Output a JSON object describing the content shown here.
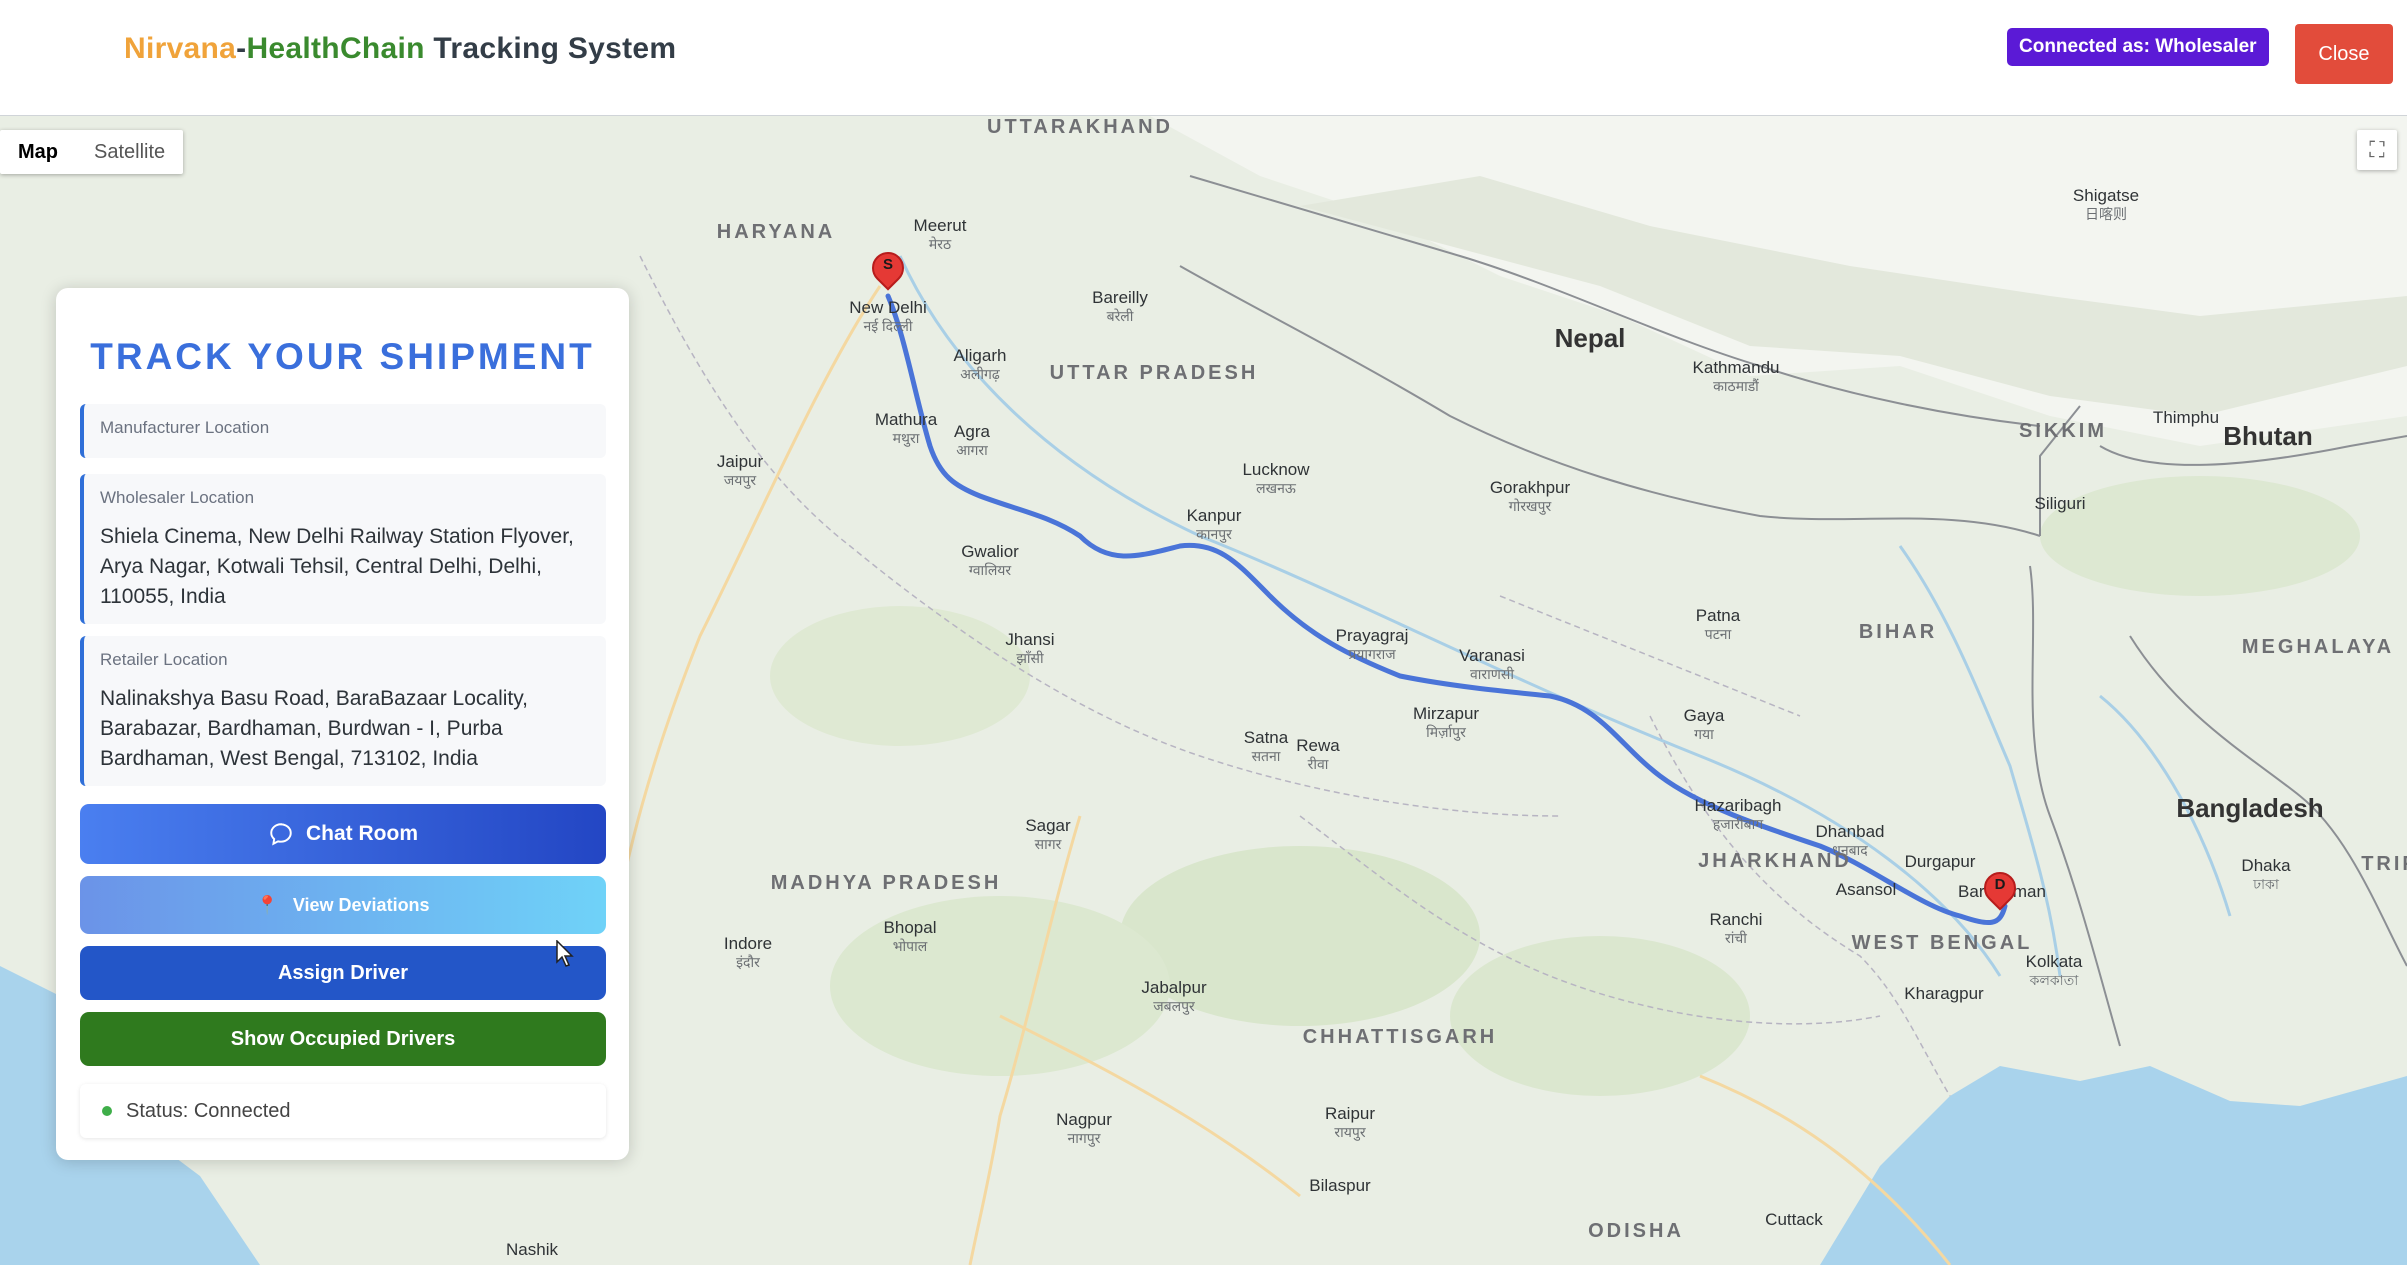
{
  "header": {
    "brand_part1": "Nirvana",
    "brand_sep": "-",
    "brand_part2": "HealthChain",
    "brand_part3": " Tracking System",
    "connected_badge": "Connected as: Wholesaler",
    "close_label": "Close"
  },
  "map": {
    "map_type": {
      "map": "Map",
      "satellite": "Satellite",
      "active": "Map"
    },
    "fullscreen_icon": "fullscreen-icon",
    "route_color": "#4a74d8",
    "markers": {
      "start_label": "S",
      "end_label": "D"
    },
    "countries": [
      "Nepal",
      "Bhutan",
      "Bangladesh"
    ],
    "states": [
      "UTTARAKHAND",
      "HARYANA",
      "UTTAR PRADESH",
      "BIHAR",
      "JHARKHAND",
      "WEST BENGAL",
      "MADHYA PRADESH",
      "CHHATTISGARH",
      "SIKKIM",
      "MEGHALAYA",
      "ODISHA",
      "TRIP"
    ],
    "cities": [
      {
        "en": "New Delhi",
        "local": "नई दिल्ली"
      },
      {
        "en": "Agra",
        "local": "आगरा"
      },
      {
        "en": "Kanpur",
        "local": "कानपुर"
      },
      {
        "en": "Lucknow",
        "local": "लखनऊ"
      },
      {
        "en": "Prayagraj",
        "local": "प्रयागराज"
      },
      {
        "en": "Varanasi",
        "local": "वाराणसी"
      },
      {
        "en": "Patna",
        "local": "पटना"
      },
      {
        "en": "Gaya",
        "local": "गया"
      },
      {
        "en": "Kathmandu",
        "local": "काठमाडौं"
      },
      {
        "en": "Jaipur",
        "local": "जयपुर"
      },
      {
        "en": "Gwalior",
        "local": "ग्वालियर"
      },
      {
        "en": "Bhopal",
        "local": "भोपाल"
      },
      {
        "en": "Indore",
        "local": "इंदौर"
      },
      {
        "en": "Nagpur",
        "local": "नागपुर"
      },
      {
        "en": "Ranchi",
        "local": "रांची"
      },
      {
        "en": "Kolkata",
        "local": "কলকাতা"
      },
      {
        "en": "Dhaka",
        "local": "ঢাকা"
      },
      {
        "en": "Raipur",
        "local": "रायपुर"
      },
      {
        "en": "Jabalpur",
        "local": "जबलपुर"
      },
      {
        "en": "Hazaribagh",
        "local": "हजारीबाग"
      },
      {
        "en": "Dhanbad",
        "local": "धनबाद"
      },
      {
        "en": "Bardhaman",
        "local": ""
      },
      {
        "en": "Thimphu",
        "local": ""
      },
      {
        "en": "Shigatse",
        "local": "日喀则"
      },
      {
        "en": "Meerut",
        "local": "मेरठ"
      },
      {
        "en": "Aligarh",
        "local": "अलीगढ़"
      },
      {
        "en": "Mathura",
        "local": "मथुरा"
      },
      {
        "en": "Bareilly",
        "local": "बरेली"
      },
      {
        "en": "Jhansi",
        "local": "झाँसी"
      },
      {
        "en": "Satna",
        "local": "सतना"
      },
      {
        "en": "Rewa",
        "local": "रीवा"
      },
      {
        "en": "Mirzapur",
        "local": "मिर्ज़ापुर"
      },
      {
        "en": "Gorakhpur",
        "local": "गोरखपुर"
      },
      {
        "en": "Sagar",
        "local": "सागर"
      },
      {
        "en": "Bilaspur",
        "local": ""
      },
      {
        "en": "Nashik",
        "local": ""
      },
      {
        "en": "Cuttack",
        "local": ""
      },
      {
        "en": "Durgapur",
        "local": ""
      },
      {
        "en": "Asansol",
        "local": ""
      },
      {
        "en": "Kharagpur",
        "local": ""
      },
      {
        "en": "Siliguri",
        "local": ""
      }
    ]
  },
  "panel": {
    "title": "TRACK YOUR SHIPMENT",
    "manufacturer_label": "Manufacturer Location",
    "manufacturer_value": "",
    "wholesaler_label": "Wholesaler Location",
    "wholesaler_value": "Shiela Cinema, New Delhi Railway Station Flyover, Arya Nagar, Kotwali Tehsil, Central Delhi, Delhi, 110055, India",
    "retailer_label": "Retailer Location",
    "retailer_value": "Nalinakshya Basu Road, BaraBazaar Locality, Barabazar, Bardhaman, Burdwan - I, Purba Bardhaman, West Bengal, 713102, India",
    "chat_button": "Chat Room",
    "deviations_button": "View Deviations",
    "assign_button": "Assign Driver",
    "occupied_button": "Show Occupied Drivers",
    "status_text": "Status: Connected",
    "status_color": "#3fae49"
  }
}
